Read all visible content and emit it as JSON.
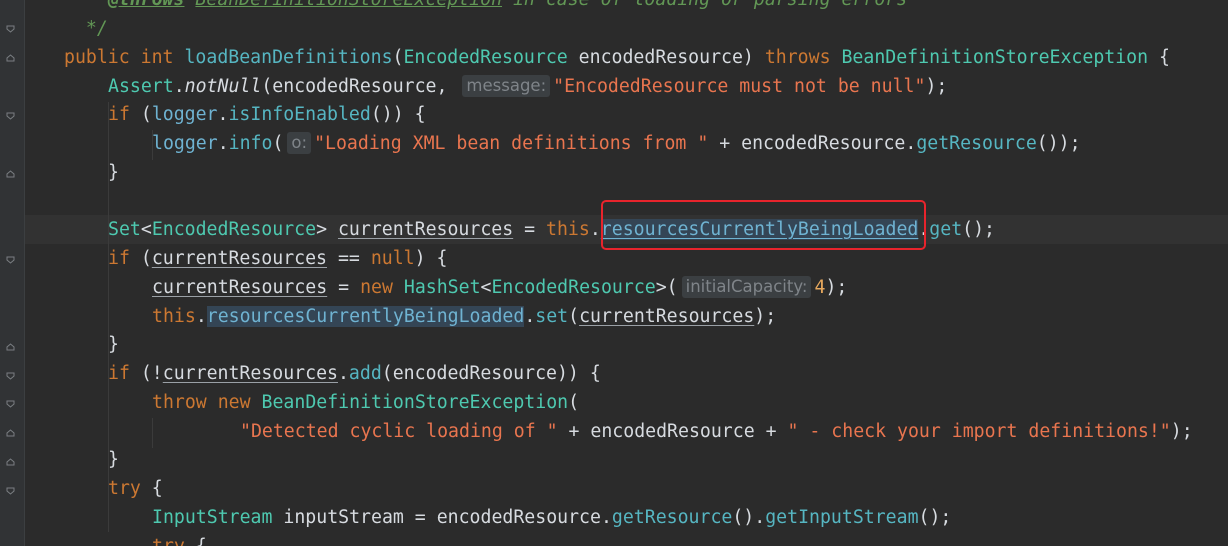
{
  "editor": {
    "accent_colors": {
      "keyword": "#cc7832",
      "string": "#e9754f",
      "type": "#4ec9b0",
      "method": "#56b6c2",
      "field": "#6fb3d2",
      "selection_box": "#e8242c"
    },
    "code": {
      "l0": {
        "tag": "@throws",
        "cls": "BeanDefinitionStoreException",
        "rest": " in case of loading or parsing errors"
      },
      "l1": {
        "end": "*/"
      },
      "l2": {
        "public": "public",
        "int": "int",
        "method": "loadBeanDefinitions",
        "paren_open": "(",
        "ptype": "EncodedResource",
        "pname": " encodedResource) ",
        "throws": "throws",
        "exc": "BeanDefinitionStoreException",
        "brace": " {"
      },
      "l3": {
        "assert": "Assert",
        "dot": ".",
        "notnull": "notNull",
        "args": "(encodedResource, ",
        "hint": "message:",
        "str": "\"EncodedResource must not be null\"",
        "end": ");"
      },
      "l4": {
        "if": "if",
        "open": " (",
        "logger": "logger",
        "dot": ".",
        "call": "isInfoEnabled",
        "end": "()) {"
      },
      "l5": {
        "logger": "logger",
        "dot": ".",
        "info": "info",
        "paren": "(",
        "hint": "o:",
        "str": "\"Loading XML bean definitions from \"",
        "plus": " + encodedResource.",
        "getres": "getResource",
        "end": "());"
      },
      "l6": {
        "brace": "}"
      },
      "l7": {
        "set": "Set",
        "lt": "<",
        "type": "EncodedResource",
        "gt": "> ",
        "var": "currentResources",
        "eq": " = ",
        "this": "this",
        "dot": ".",
        "field": "resourcesCurrentlyBeingLoaded",
        "dot2": ".",
        "get": "get",
        "end": "();"
      },
      "l8": {
        "if": "if",
        "open": " (",
        "var": "currentResources",
        "eq": " == ",
        "null": "null",
        "end": ") {"
      },
      "l9": {
        "var": "currentResources",
        "eq": " = ",
        "new": "new",
        "hs": "HashSet",
        "lt": "<",
        "type": "EncodedResource",
        "gt": ">(",
        "hint": "initialCapacity:",
        "num": "4",
        "end": ");"
      },
      "l10": {
        "this": "this",
        "dot": ".",
        "field": "resourcesCurrentlyBeingLoaded",
        "dot2": ".",
        "set": "set",
        "open": "(",
        "var": "currentResources",
        "end": ");"
      },
      "l11": {
        "brace": "}"
      },
      "l12": {
        "if": "if",
        "open": " (!",
        "var": "currentResources",
        "dot": ".",
        "add": "add",
        "end": "(encodedResource)) {"
      },
      "l13": {
        "throw": "throw",
        "new": "new",
        "exc": "BeanDefinitionStoreException",
        "paren": "("
      },
      "l14": {
        "str1": "\"Detected cyclic loading of \"",
        "mid": " + encodedResource + ",
        "str2": "\" - check your import definitions!\"",
        "end": ");"
      },
      "l15": {
        "brace": "}"
      },
      "l16": {
        "try": "try",
        "brace": " {"
      },
      "l17": {
        "is": "InputStream",
        "name": " inputStream = encodedResource.",
        "getres": "getResource",
        "mid": "().",
        "getis": "getInputStream",
        "end": "();"
      },
      "l18": {
        "try": "try",
        "brace": " {"
      }
    }
  }
}
